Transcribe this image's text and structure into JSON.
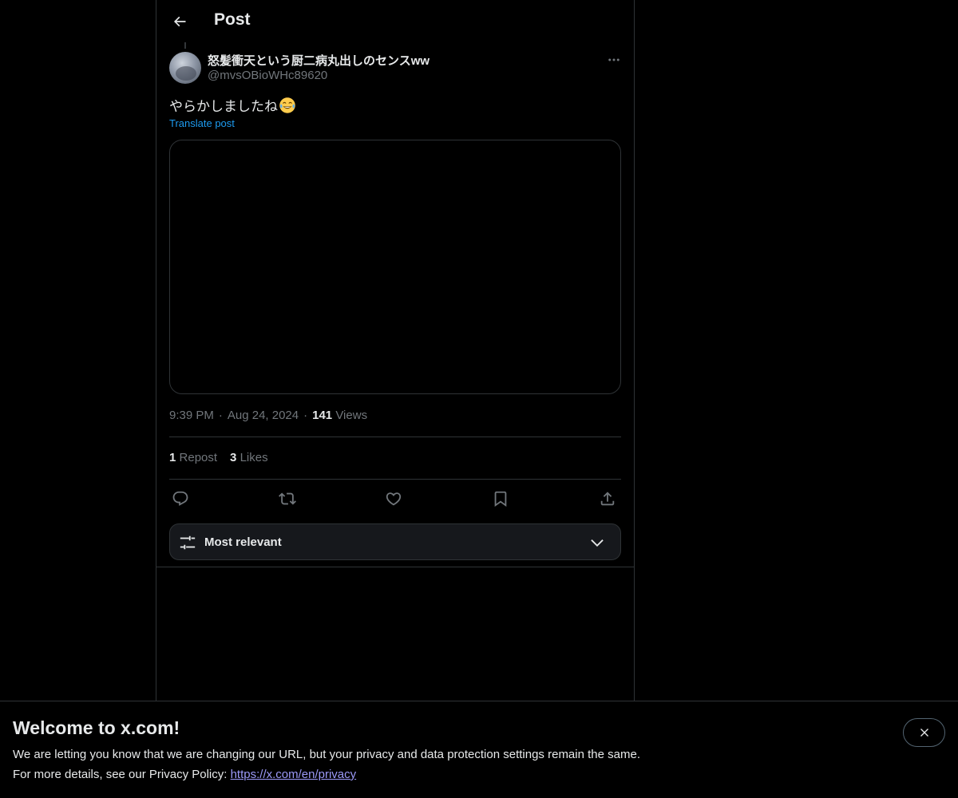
{
  "header": {
    "title": "Post"
  },
  "post": {
    "display_name": "怒髪衝天という厨二病丸出しのセンスww",
    "handle": "@mvsOBioWHc89620",
    "text": "やらかしましたね",
    "emoji": "tears-of-joy-emoji",
    "translate_label": "Translate post",
    "time": "9:39 PM",
    "date": "Aug 24, 2024",
    "separator": "·",
    "views_count": "141",
    "views_label": "Views"
  },
  "stats": {
    "reposts_count": "1",
    "reposts_label": "Repost",
    "likes_count": "3",
    "likes_label": "Likes"
  },
  "actions": [
    "reply-icon",
    "repost-icon",
    "like-icon",
    "bookmark-icon",
    "share-icon"
  ],
  "sort": {
    "label": "Most relevant"
  },
  "banner": {
    "title": "Welcome to x.com!",
    "line1": "We are letting you know that we are changing our URL, but your privacy and data protection settings remain the same.",
    "line2_prefix": "For more details, see our Privacy Policy: ",
    "link": "https://x.com/en/privacy"
  },
  "colors": {
    "background": "#000000",
    "text": "#e7e9ea",
    "secondary": "#71767b",
    "accent": "#1d9bf0",
    "border": "#2f3336",
    "link": "#9b99f7"
  }
}
